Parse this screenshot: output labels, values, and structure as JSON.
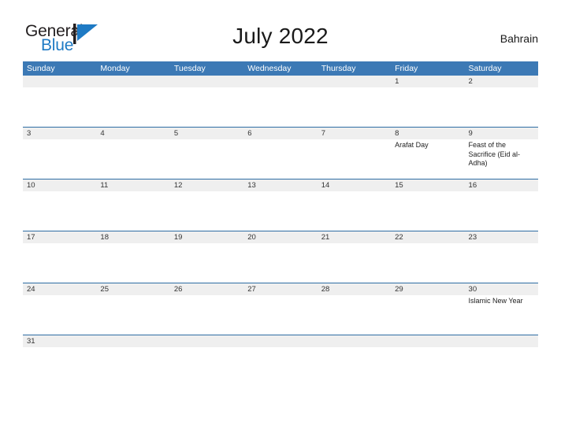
{
  "brand": {
    "name_part1": "General",
    "name_part2": "Blue",
    "mark": "triangle-logo"
  },
  "header": {
    "title": "July 2022",
    "country": "Bahrain"
  },
  "colors": {
    "header_blue": "#3c79b5",
    "divider_blue": "#2e6da4",
    "date_band_gray": "#efefef",
    "brand_blue": "#1e7ac4"
  },
  "calendar": {
    "weekdays": [
      "Sunday",
      "Monday",
      "Tuesday",
      "Wednesday",
      "Thursday",
      "Friday",
      "Saturday"
    ],
    "weeks": [
      {
        "short": false,
        "days": [
          {
            "num": "",
            "events": []
          },
          {
            "num": "",
            "events": []
          },
          {
            "num": "",
            "events": []
          },
          {
            "num": "",
            "events": []
          },
          {
            "num": "",
            "events": []
          },
          {
            "num": "1",
            "events": []
          },
          {
            "num": "2",
            "events": []
          }
        ]
      },
      {
        "short": false,
        "days": [
          {
            "num": "3",
            "events": []
          },
          {
            "num": "4",
            "events": []
          },
          {
            "num": "5",
            "events": []
          },
          {
            "num": "6",
            "events": []
          },
          {
            "num": "7",
            "events": []
          },
          {
            "num": "8",
            "events": [
              "Arafat Day"
            ]
          },
          {
            "num": "9",
            "events": [
              "Feast of the Sacrifice (Eid al-Adha)"
            ]
          }
        ]
      },
      {
        "short": false,
        "days": [
          {
            "num": "10",
            "events": []
          },
          {
            "num": "11",
            "events": []
          },
          {
            "num": "12",
            "events": []
          },
          {
            "num": "13",
            "events": []
          },
          {
            "num": "14",
            "events": []
          },
          {
            "num": "15",
            "events": []
          },
          {
            "num": "16",
            "events": []
          }
        ]
      },
      {
        "short": false,
        "days": [
          {
            "num": "17",
            "events": []
          },
          {
            "num": "18",
            "events": []
          },
          {
            "num": "19",
            "events": []
          },
          {
            "num": "20",
            "events": []
          },
          {
            "num": "21",
            "events": []
          },
          {
            "num": "22",
            "events": []
          },
          {
            "num": "23",
            "events": []
          }
        ]
      },
      {
        "short": false,
        "days": [
          {
            "num": "24",
            "events": []
          },
          {
            "num": "25",
            "events": []
          },
          {
            "num": "26",
            "events": []
          },
          {
            "num": "27",
            "events": []
          },
          {
            "num": "28",
            "events": []
          },
          {
            "num": "29",
            "events": []
          },
          {
            "num": "30",
            "events": [
              "Islamic New Year"
            ]
          }
        ]
      },
      {
        "short": true,
        "days": [
          {
            "num": "31",
            "events": []
          },
          {
            "num": "",
            "events": []
          },
          {
            "num": "",
            "events": []
          },
          {
            "num": "",
            "events": []
          },
          {
            "num": "",
            "events": []
          },
          {
            "num": "",
            "events": []
          },
          {
            "num": "",
            "events": []
          }
        ]
      }
    ]
  }
}
